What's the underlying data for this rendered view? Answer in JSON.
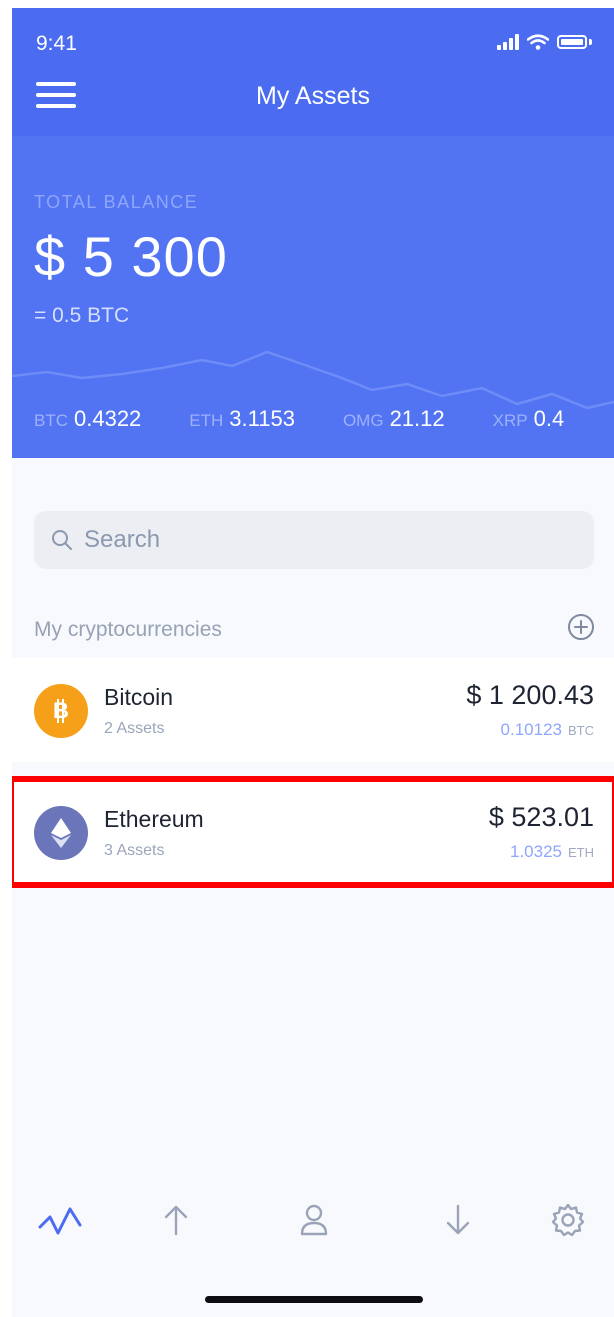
{
  "status": {
    "time": "9:41"
  },
  "header": {
    "title": "My Assets"
  },
  "balance": {
    "label": "TOTAL BALANCE",
    "amount": "$ 5 300",
    "btc": "= 0.5 BTC",
    "tickers": [
      {
        "symbol": "BTC",
        "value": "0.4322"
      },
      {
        "symbol": "ETH",
        "value": "3.1153"
      },
      {
        "symbol": "OMG",
        "value": "21.12"
      },
      {
        "symbol": "XRP",
        "value": "0.4"
      }
    ]
  },
  "search": {
    "placeholder": "Search"
  },
  "section": {
    "title": "My cryptocurrencies"
  },
  "coins": [
    {
      "name": "Bitcoin",
      "assets": "2 Assets",
      "usd": "$ 1 200.43",
      "amount": "0.10123",
      "unit": "BTC",
      "color": "#f6a01a"
    },
    {
      "name": "Ethereum",
      "assets": "3 Assets",
      "usd": "$ 523.01",
      "amount": "1.0325",
      "unit": "ETH",
      "color": "#6a76b9"
    }
  ],
  "colors": {
    "primary": "#4b6cf0",
    "panel": "#5274f3",
    "highlight": "#ff0000",
    "active_tab": "#4b6cf0",
    "inactive_tab": "#9aa3b8"
  },
  "tabs": [
    "activity-icon",
    "send-icon",
    "user-icon",
    "receive-icon",
    "gear-icon"
  ]
}
